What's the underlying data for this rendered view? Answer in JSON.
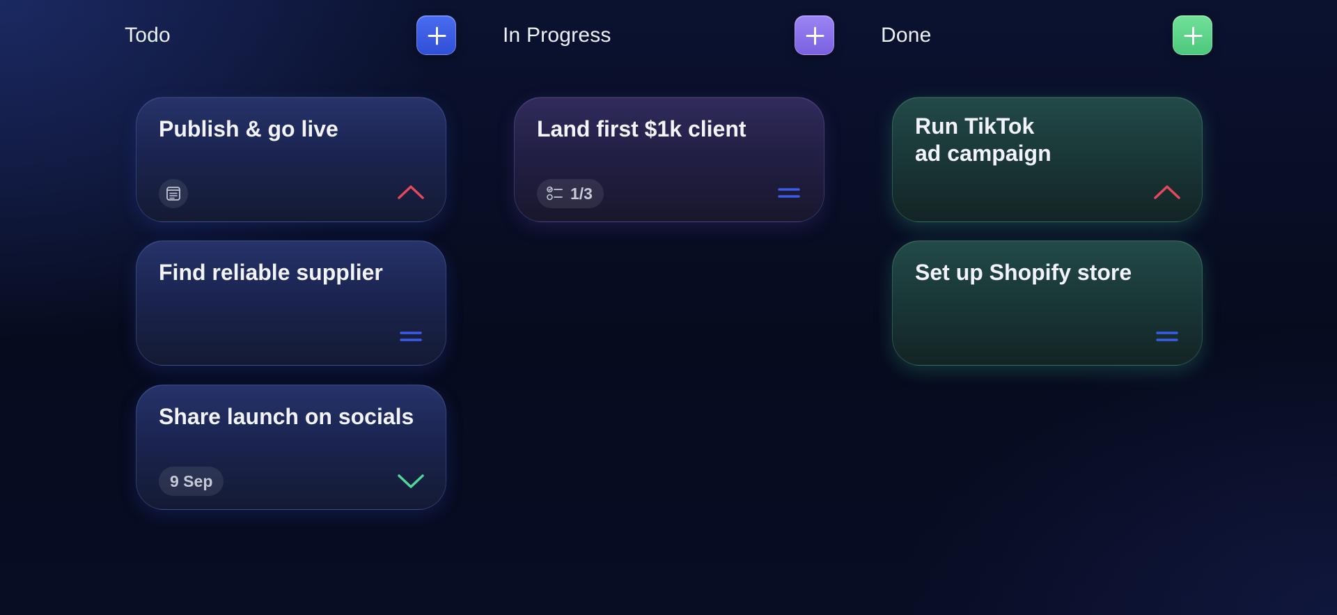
{
  "colors": {
    "todo_accent": "#3a5ce6",
    "in_progress_accent": "#8a70ea",
    "done_accent": "#5fd48b",
    "priority_high": "#e5485e",
    "priority_medium": "#3a5ce6",
    "priority_low": "#4fd89a"
  },
  "columns": [
    {
      "title": "Todo",
      "add_icon": "plus-icon",
      "cards": [
        {
          "title": "Publish & go live",
          "tag_icon": "note-icon",
          "priority": "high",
          "priority_icon": "chevron-up-icon"
        },
        {
          "title": "Find reliable supplier",
          "priority": "medium",
          "priority_icon": "equals-icon"
        },
        {
          "title": "Share launch on socials",
          "due_date": "9 Sep",
          "priority": "low",
          "priority_icon": "chevron-down-icon"
        }
      ]
    },
    {
      "title": "In Progress",
      "add_icon": "plus-icon",
      "cards": [
        {
          "title": "Land first $1k client",
          "tag_icon": "checklist-icon",
          "checklist": "1/3",
          "priority": "medium",
          "priority_icon": "equals-icon"
        }
      ]
    },
    {
      "title": "Done",
      "add_icon": "plus-icon",
      "cards": [
        {
          "title": "Run TikTok\nad campaign",
          "priority": "high",
          "priority_icon": "chevron-up-icon"
        },
        {
          "title": "Set up Shopify store",
          "priority": "medium",
          "priority_icon": "equals-icon"
        }
      ]
    }
  ]
}
